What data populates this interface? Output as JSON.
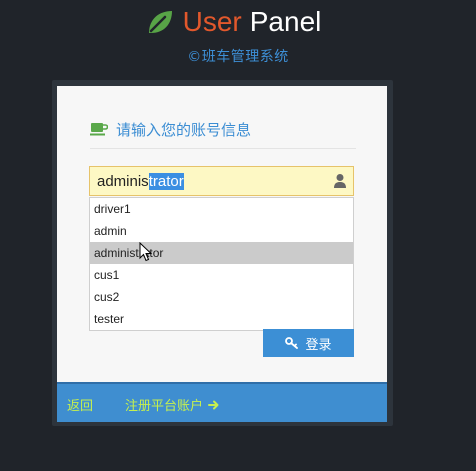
{
  "brand": {
    "word1": "User",
    "word2": "Panel",
    "subtitle": "©班车管理系统"
  },
  "form": {
    "title": "请输入您的账号信息",
    "username_typed": "adminis",
    "username_selected": "trator",
    "login_label": "登录"
  },
  "dropdown": {
    "options": [
      "driver1",
      "admin",
      "administrator",
      "cus1",
      "cus2",
      "tester"
    ],
    "highlighted": "administrator"
  },
  "footer": {
    "back_label": "返回",
    "register_label": "注册平台账户"
  },
  "colors": {
    "accent": "#3c8fd5",
    "brand_orange": "#e2582c",
    "link_green": "#c6f04e",
    "leaf_green": "#58a447"
  }
}
